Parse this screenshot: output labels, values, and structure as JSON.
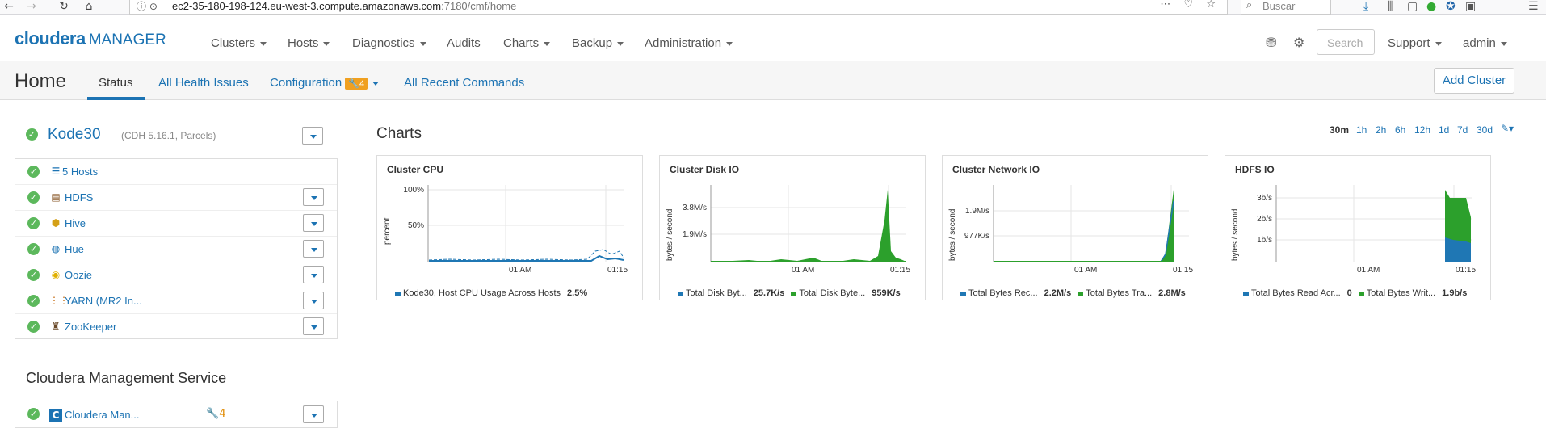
{
  "browser": {
    "url_host": "ec2-35-180-198-124.eu-west-3.compute.amazonaws.com",
    "url_path": ":7180/cmf/home",
    "search_placeholder": "Buscar"
  },
  "nav": {
    "logo_brand": "cloudera",
    "logo_product": "MANAGER",
    "items": [
      "Clusters",
      "Hosts",
      "Diagnostics",
      "Audits",
      "Charts",
      "Backup",
      "Administration"
    ],
    "search_placeholder": "Search",
    "support": "Support",
    "user": "admin"
  },
  "subheader": {
    "title": "Home",
    "tabs": [
      "Status",
      "All Health Issues",
      "Configuration",
      "All Recent Commands"
    ],
    "config_badge": "4",
    "add_cluster": "Add Cluster"
  },
  "cluster": {
    "name": "Kode30",
    "meta": "(CDH 5.16.1, Parcels)",
    "services": [
      {
        "name": "5 Hosts",
        "icon": "hosts-list-icon"
      },
      {
        "name": "HDFS",
        "icon": "hdfs-icon"
      },
      {
        "name": "Hive",
        "icon": "hive-icon"
      },
      {
        "name": "Hue",
        "icon": "hue-icon"
      },
      {
        "name": "Oozie",
        "icon": "oozie-icon"
      },
      {
        "name": "YARN (MR2 In...",
        "icon": "yarn-icon"
      },
      {
        "name": "ZooKeeper",
        "icon": "zookeeper-icon"
      }
    ]
  },
  "mgmt": {
    "title": "Cloudera Management Service",
    "service_name": "Cloudera Man...",
    "warnings": "4"
  },
  "charts_section": {
    "title": "Charts",
    "ranges": [
      "30m",
      "1h",
      "2h",
      "6h",
      "12h",
      "1d",
      "7d",
      "30d"
    ],
    "active_range": "30m"
  },
  "colors": {
    "blue": "#1f77b4",
    "green": "#2ca02c",
    "link": "#1c73b3",
    "ok": "#5cb85c"
  },
  "chart_data": [
    {
      "type": "line",
      "title": "Cluster CPU",
      "ylabel": "percent",
      "xticks": [
        "01 AM",
        "01:15"
      ],
      "yticks": [
        "100%",
        "50%"
      ],
      "legend": [
        {
          "name": "Kode30, Host CPU Usage Across Hosts",
          "value": "2.5%"
        }
      ]
    },
    {
      "type": "area",
      "title": "Cluster Disk IO",
      "ylabel": "bytes / second",
      "xticks": [
        "01 AM",
        "01:15"
      ],
      "yticks": [
        "3.8M/s",
        "1.9M/s"
      ],
      "legend": [
        {
          "name": "Total Disk Byt...",
          "value": "25.7K/s"
        },
        {
          "name": "Total Disk Byte...",
          "value": "959K/s"
        }
      ]
    },
    {
      "type": "area",
      "title": "Cluster Network IO",
      "ylabel": "bytes / second",
      "xticks": [
        "01 AM",
        "01:15"
      ],
      "yticks": [
        "1.9M/s",
        "977K/s"
      ],
      "legend": [
        {
          "name": "Total Bytes Rec...",
          "value": "2.2M/s"
        },
        {
          "name": "Total Bytes Tra...",
          "value": "2.8M/s"
        }
      ]
    },
    {
      "type": "area",
      "title": "HDFS IO",
      "ylabel": "bytes / second",
      "xticks": [
        "01 AM",
        "01:15"
      ],
      "yticks": [
        "3b/s",
        "2b/s",
        "1b/s"
      ],
      "legend": [
        {
          "name": "Total Bytes Read Acr...",
          "value": "0"
        },
        {
          "name": "Total Bytes Writ...",
          "value": "1.9b/s"
        }
      ]
    }
  ]
}
